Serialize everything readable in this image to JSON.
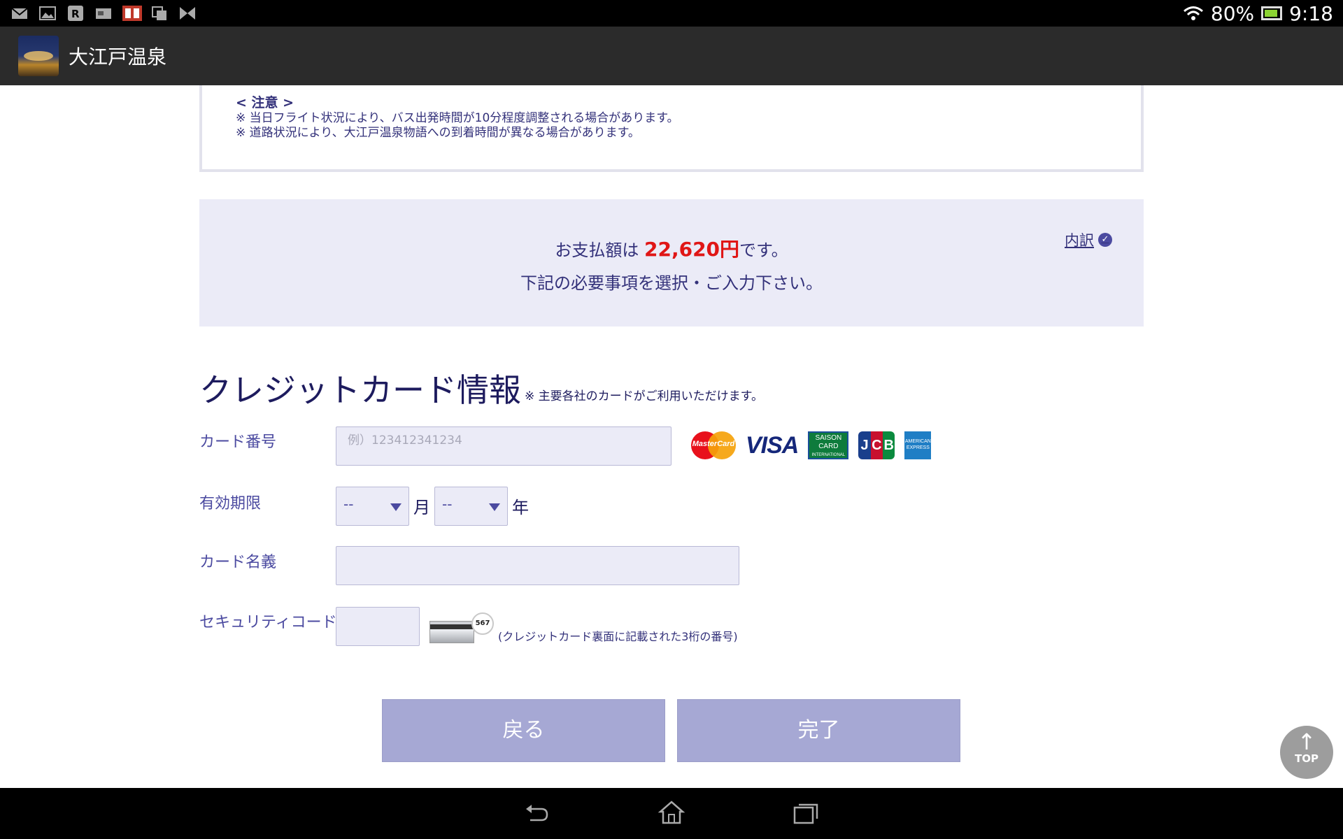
{
  "status_bar": {
    "notification_icons": [
      "mail-icon",
      "gallery-icon",
      "r-app-icon",
      "card-app-icon",
      "game-app-icon",
      "copy-icon",
      "bowtie-icon"
    ],
    "battery_percent": "80%",
    "time": "9:18"
  },
  "action_bar": {
    "app_title": "大江戸温泉"
  },
  "notice": {
    "heading": "< 注意 >",
    "lines": [
      "※ 当日フライト状況により、バス出発時間が10分程度調整される場合があります。",
      "※ 道路状況により、大江戸温泉物語への到着時間が異なる場合があります。"
    ]
  },
  "payment": {
    "prefix": "お支払額は ",
    "amount": "22,620円",
    "suffix": "です。",
    "instruction": "下記の必要事項を選択・ご入力下さい。",
    "breakdown_label": "内訳"
  },
  "credit_card": {
    "title": "クレジットカード情報",
    "note": "※ 主要各社のカードがご利用いただけます。",
    "card_number_label": "カード番号",
    "card_number_placeholder": "例）123412341234",
    "expiry_label": "有効期限",
    "month_value": "--",
    "month_unit": "月",
    "year_value": "--",
    "year_unit": "年",
    "name_label": "カード名義",
    "security_label": "セキュリティコード",
    "security_hint": "(クレジットカード裏面に記載された3桁の番号)",
    "cvc_sample": "567",
    "brands": {
      "mastercard": "MasterCard",
      "visa": "VISA",
      "saison": [
        "SAISON",
        "CARD",
        "INTERNATIONAL"
      ],
      "jcb": [
        "J",
        "C",
        "B"
      ],
      "amex": "AMERICAN EXPRESS"
    }
  },
  "buttons": {
    "back": "戻る",
    "done": "完了",
    "top_arrow": "↑",
    "top": "TOP"
  },
  "colors": {
    "accent": "#4b4aa0",
    "amount": "#e01616",
    "button": "#a6a8d4",
    "panel": "#ebebf7"
  }
}
